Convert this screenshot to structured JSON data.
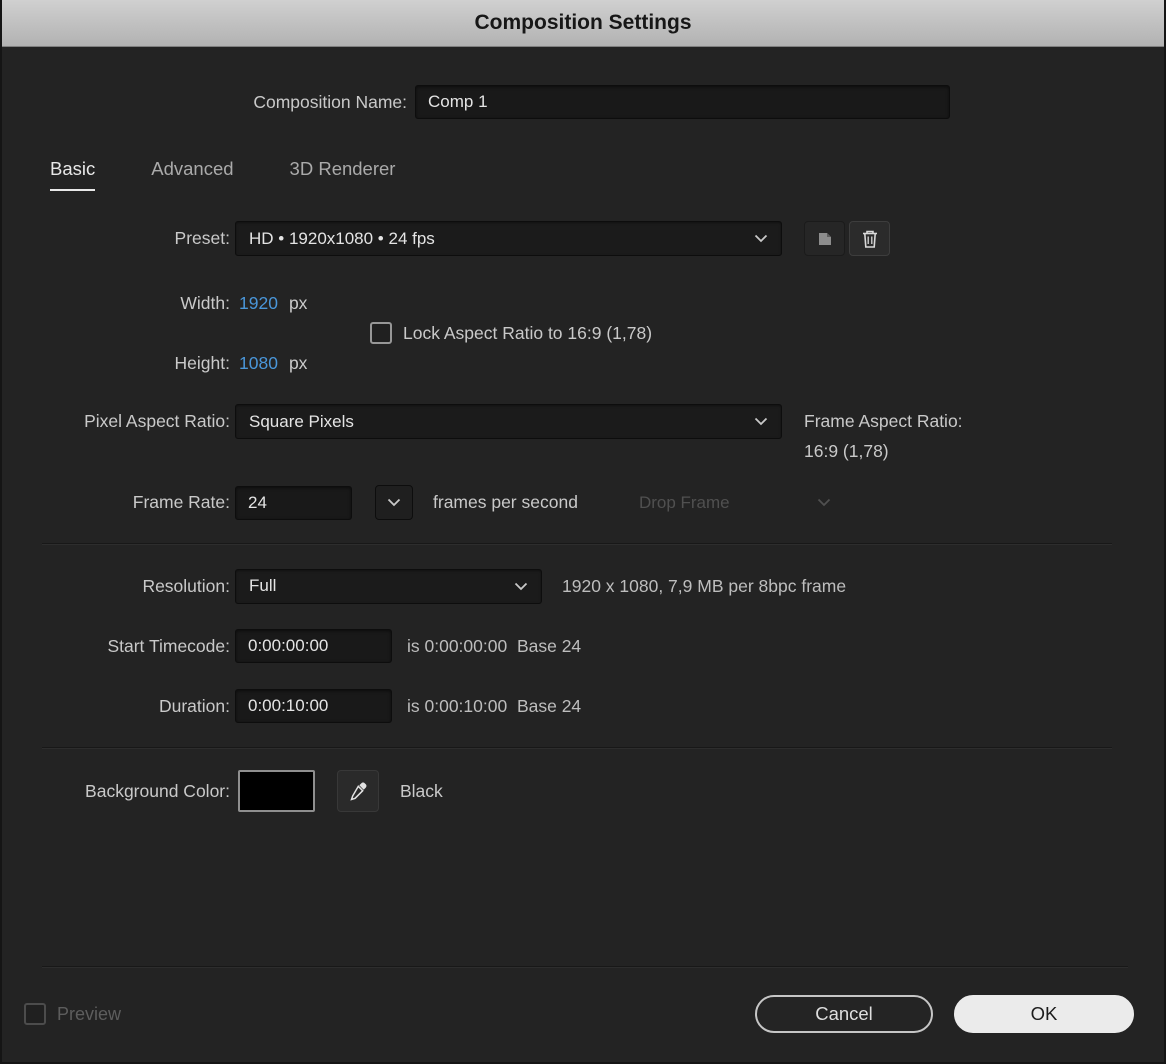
{
  "dialog": {
    "title": "Composition Settings"
  },
  "composition_name": {
    "label": "Composition Name:",
    "value": "Comp 1"
  },
  "tabs": {
    "basic": "Basic",
    "advanced": "Advanced",
    "renderer": "3D Renderer"
  },
  "preset": {
    "label": "Preset:",
    "value": "HD • 1920x1080 • 24 fps"
  },
  "dimensions": {
    "width_label": "Width:",
    "width_value": "1920",
    "width_unit": "px",
    "height_label": "Height:",
    "height_value": "1080",
    "height_unit": "px",
    "lock_label": "Lock Aspect Ratio to 16:9 (1,78)"
  },
  "pixel_aspect_ratio": {
    "label": "Pixel Aspect Ratio:",
    "value": "Square Pixels",
    "frame_aspect_label": "Frame Aspect Ratio:",
    "frame_aspect_value": "16:9 (1,78)"
  },
  "frame_rate": {
    "label": "Frame Rate:",
    "value": "24",
    "unit": "frames per second",
    "drop_frame": "Drop Frame"
  },
  "resolution": {
    "label": "Resolution:",
    "value": "Full",
    "info": "1920 x 1080, 7,9 MB per 8bpc frame"
  },
  "start_timecode": {
    "label": "Start Timecode:",
    "value": "0:00:00:00",
    "info": "is 0:00:00:00  Base 24"
  },
  "duration": {
    "label": "Duration:",
    "value": "0:00:10:00",
    "info": "is 0:00:10:00  Base 24"
  },
  "background_color": {
    "label": "Background Color:",
    "value_name": "Black",
    "swatch_color": "#000000"
  },
  "footer": {
    "preview_label": "Preview",
    "cancel_label": "Cancel",
    "ok_label": "OK"
  },
  "colors": {
    "accent_blue": "#4a96d9",
    "dialog_bg": "#232323"
  }
}
